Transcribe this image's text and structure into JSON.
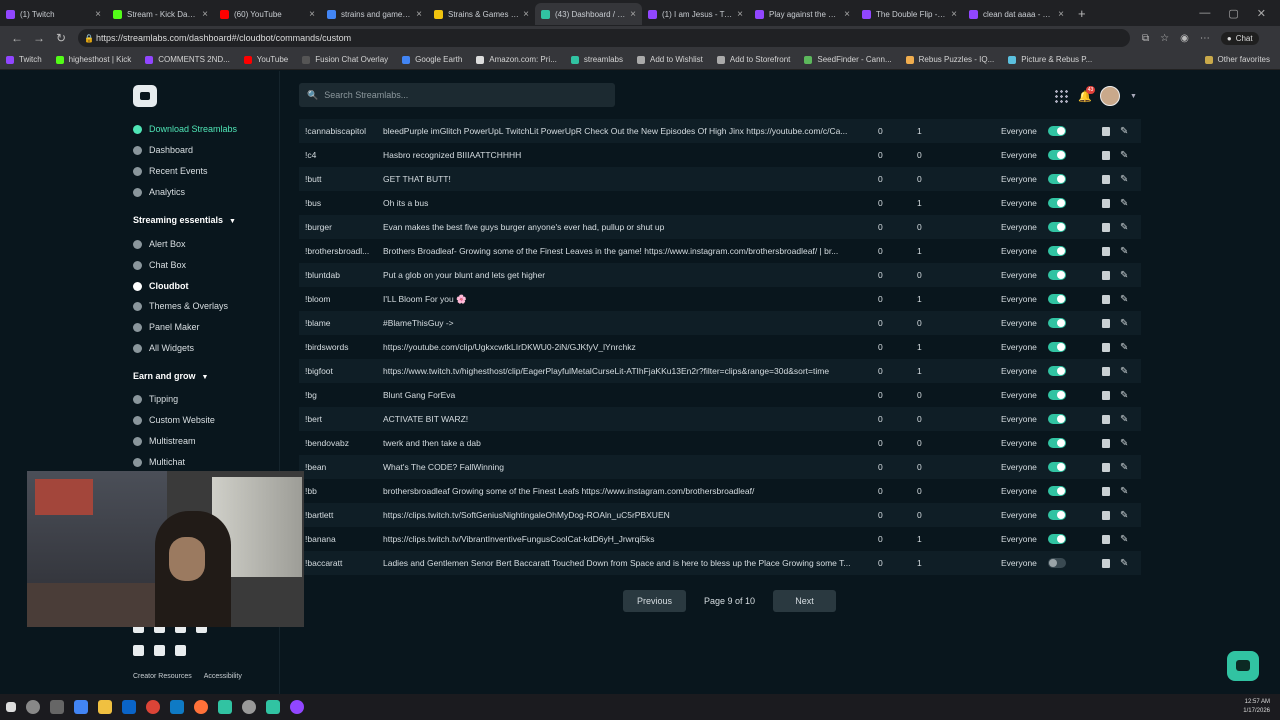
{
  "browser": {
    "tabs": [
      {
        "title": "(1) Twitch",
        "color": "#9146ff"
      },
      {
        "title": "Stream - Kick Dashboard",
        "color": "#53fc18"
      },
      {
        "title": "(60) YouTube",
        "color": "#ff0000"
      },
      {
        "title": "strains and games ever...",
        "color": "#4285f4"
      },
      {
        "title": "Strains & Games 3 - Th...",
        "color": "#f1c40f"
      },
      {
        "title": "(43) Dashboard / Strea...",
        "color": "#31c3a2",
        "active": true
      },
      {
        "title": "(1) I am Jesus - Twitch",
        "color": "#9146ff"
      },
      {
        "title": "Play against the Comm...",
        "color": "#9146ff"
      },
      {
        "title": "The Double Flip - NBC...",
        "color": "#9146ff"
      },
      {
        "title": "clean dat aaaa - Twitch",
        "color": "#9146ff"
      }
    ],
    "url": "https://streamlabs.com/dashboard#/cloudbot/commands/custom",
    "chat_label": "Chat",
    "bookmarks": [
      {
        "label": "Twitch",
        "color": "#9146ff"
      },
      {
        "label": "highesthost | Kick",
        "color": "#53fc18"
      },
      {
        "label": "COMMENTS 2ND...",
        "color": "#9146ff"
      },
      {
        "label": "YouTube",
        "color": "#ff0000"
      },
      {
        "label": "Fusion Chat Overlay",
        "color": "#555555"
      },
      {
        "label": "Google Earth",
        "color": "#4285f4"
      },
      {
        "label": "Amazon.com: Pri...",
        "color": "#dddddd"
      },
      {
        "label": "streamlabs",
        "color": "#31c3a2"
      },
      {
        "label": "Add to Wishlist",
        "color": "#aaaaaa"
      },
      {
        "label": "Add to Storefront",
        "color": "#aaaaaa"
      },
      {
        "label": "SeedFinder - Cann...",
        "color": "#5cb85c"
      },
      {
        "label": "Rebus Puzzles - IQ...",
        "color": "#f0ad4e"
      },
      {
        "label": "Picture & Rebus P...",
        "color": "#5bc0de"
      }
    ],
    "other_favorites": "Other favorites"
  },
  "sidebar": {
    "download": "Download Streamlabs",
    "items_top": [
      "Dashboard",
      "Recent Events",
      "Analytics"
    ],
    "section1": "Streaming essentials",
    "items_ess": [
      "Alert Box",
      "Chat Box",
      "Cloudbot",
      "Themes & Overlays",
      "Panel Maker",
      "All Widgets"
    ],
    "section2": "Earn and grow",
    "items_earn": [
      "Tipping",
      "Custom Website",
      "Multistream",
      "Multichat"
    ],
    "footer": [
      "Creator Resources",
      "Accessibility"
    ]
  },
  "header": {
    "search_placeholder": "Search Streamlabs...",
    "notif_count": "43"
  },
  "commands": [
    {
      "cmd": "!cannabiscapitol",
      "resp": "bleedPurple imGlitch PowerUpL TwitchLit PowerUpR Check Out the New Episodes Of High Jinx https://youtube.com/c/Ca...",
      "n1": "0",
      "n2": "1",
      "perm": "Everyone",
      "on": true
    },
    {
      "cmd": "!c4",
      "resp": "Hasbro recognized BIIIAATTCHHHH",
      "n1": "0",
      "n2": "0",
      "perm": "Everyone",
      "on": true
    },
    {
      "cmd": "!butt",
      "resp": "GET THAT BUTT!",
      "n1": "0",
      "n2": "0",
      "perm": "Everyone",
      "on": true
    },
    {
      "cmd": "!bus",
      "resp": "Oh its a bus",
      "n1": "0",
      "n2": "1",
      "perm": "Everyone",
      "on": true
    },
    {
      "cmd": "!burger",
      "resp": "Evan makes the best five guys burger anyone's ever had, pullup or shut up",
      "n1": "0",
      "n2": "0",
      "perm": "Everyone",
      "on": true
    },
    {
      "cmd": "!brothersbroadl...",
      "resp": "Brothers Broadleaf- Growing some of the Finest Leaves in the game! https://www.instagram.com/brothersbroadleaf/ | br...",
      "n1": "0",
      "n2": "1",
      "perm": "Everyone",
      "on": true
    },
    {
      "cmd": "!bluntdab",
      "resp": "Put a glob on your blunt and lets get higher",
      "n1": "0",
      "n2": "0",
      "perm": "Everyone",
      "on": true
    },
    {
      "cmd": "!bloom",
      "resp": "I'LL Bloom For you 🌸",
      "n1": "0",
      "n2": "1",
      "perm": "Everyone",
      "on": true
    },
    {
      "cmd": "!blame",
      "resp": "#BlameThisGuy ->",
      "n1": "0",
      "n2": "0",
      "perm": "Everyone",
      "on": true
    },
    {
      "cmd": "!birdswords",
      "resp": "https://youtube.com/clip/UgkxcwtkLIrDKWU0-2iN/GJKfyV_lYnrchkz",
      "n1": "0",
      "n2": "1",
      "perm": "Everyone",
      "on": true
    },
    {
      "cmd": "!bigfoot",
      "resp": "https://www.twitch.tv/highesthost/clip/EagerPlayfulMetalCurseLit-ATIhFjaKKu13En2r?filter=clips&range=30d&sort=time",
      "n1": "0",
      "n2": "1",
      "perm": "Everyone",
      "on": true
    },
    {
      "cmd": "!bg",
      "resp": "Blunt Gang ForEva",
      "n1": "0",
      "n2": "0",
      "perm": "Everyone",
      "on": true
    },
    {
      "cmd": "!bert",
      "resp": "ACTIVATE BIT WARZ!",
      "n1": "0",
      "n2": "0",
      "perm": "Everyone",
      "on": true
    },
    {
      "cmd": "!bendovabz",
      "resp": "twerk and then take a dab",
      "n1": "0",
      "n2": "0",
      "perm": "Everyone",
      "on": true
    },
    {
      "cmd": "!bean",
      "resp": "What's The CODE? FallWinning",
      "n1": "0",
      "n2": "0",
      "perm": "Everyone",
      "on": true
    },
    {
      "cmd": "!bb",
      "resp": "brothersbroadleaf Growing some of the Finest Leafs https://www.instagram.com/brothersbroadleaf/",
      "n1": "0",
      "n2": "0",
      "perm": "Everyone",
      "on": true
    },
    {
      "cmd": "!bartlett",
      "resp": "https://clips.twitch.tv/SoftGeniusNightingaleOhMyDog-ROAln_uC5rPBXUEN",
      "n1": "0",
      "n2": "0",
      "perm": "Everyone",
      "on": true
    },
    {
      "cmd": "!banana",
      "resp": "https://clips.twitch.tv/VibrantInventiveFungusCoolCat-kdD6yH_Jrwrqi5ks",
      "n1": "0",
      "n2": "1",
      "perm": "Everyone",
      "on": true
    },
    {
      "cmd": "!baccaratt",
      "resp": "Ladies and Gentlemen Senor Bert Baccaratt Touched Down from Space and is here to bless up the Place Growing some T...",
      "n1": "0",
      "n2": "1",
      "perm": "Everyone",
      "on": false
    }
  ],
  "pager": {
    "prev": "Previous",
    "label": "Page 9 of 10",
    "next": "Next"
  },
  "taskbar": {
    "time": "12:57 AM",
    "date": "1/17/2026"
  },
  "colors": {
    "accent": "#31c3a2",
    "background": "#09161d"
  }
}
